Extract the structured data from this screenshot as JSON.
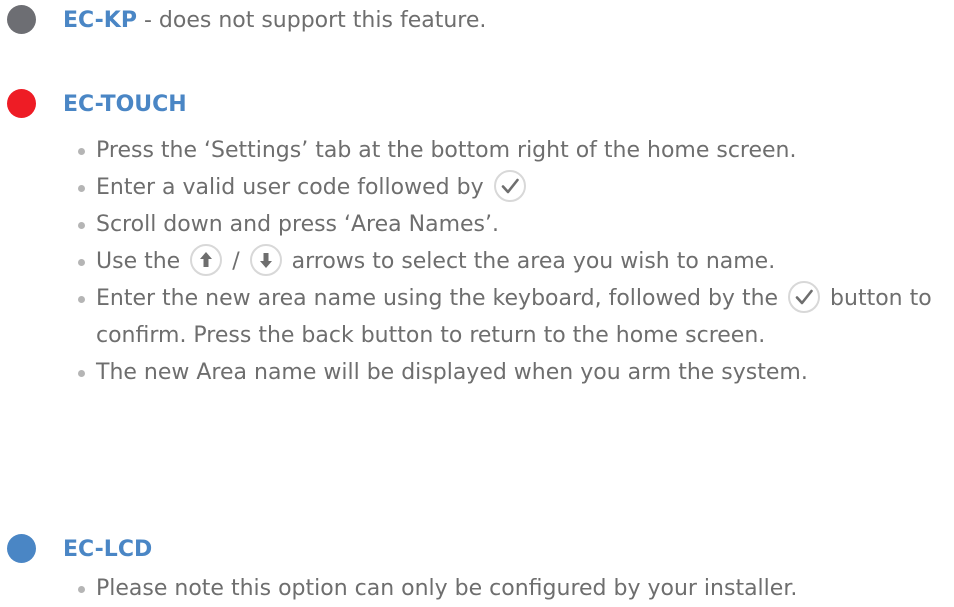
{
  "sections": {
    "kp": {
      "title": "EC-KP",
      "suffix": " - does not support this feature.",
      "dot_color": "#6d6e73"
    },
    "touch": {
      "title": "EC-TOUCH",
      "dot_color": "#ee1c25",
      "steps": {
        "s1": "Press the ‘Settings’ tab at the bottom right of the home screen.",
        "s2": "Enter a valid user code followed by",
        "s3": "Scroll down and press ‘Area Names’.",
        "s4_a": "Use the",
        "s4_sep": "/",
        "s4_b": "arrows to select the area you wish to name.",
        "s5_a": "Enter the new area name using the keyboard, followed by the",
        "s5_b": "button to confirm. Press the back button to return to the home screen.",
        "s6": "The new Area name will be displayed when you arm the system."
      },
      "icons": {
        "confirm": "check-icon",
        "up": "arrow-up-icon",
        "down": "arrow-down-icon"
      }
    },
    "lcd": {
      "title": "EC-LCD",
      "dot_color": "#4a86c5",
      "steps": {
        "s1": "Please note this option can only be configured by your installer."
      }
    }
  }
}
